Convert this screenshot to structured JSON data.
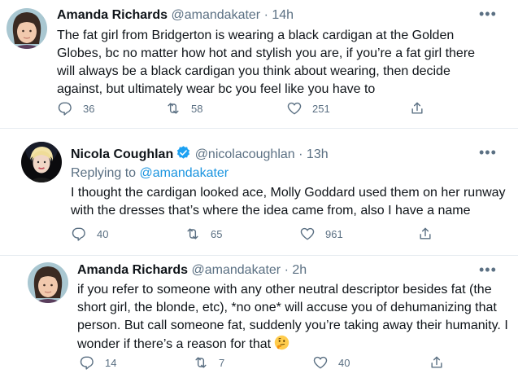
{
  "tweets": [
    {
      "name": "Amanda Richards",
      "handle": "@amandakater",
      "sep": "·",
      "time": "14h",
      "lines": [
        "The fat girl from Bridgerton is wearing a black cardigan at the Golden",
        "Globes, bc no matter how hot and stylish you are, if you’re a fat girl there",
        "will always be a black cardigan you think about wearing, then decide",
        "against, but ultimately wear bc you feel like you have to"
      ],
      "replies": "36",
      "retweets": "58",
      "likes": "251"
    },
    {
      "name": "Nicola Coughlan",
      "handle": "@nicolacoughlan",
      "sep": "·",
      "time": "13h",
      "replying_prefix": "Replying to",
      "replying_to": "@amandakater",
      "lines": [
        "I thought the cardigan looked ace, Molly Goddard used them on her runway",
        "with the dresses that’s where the idea came from, also I have a name"
      ],
      "replies": "40",
      "retweets": "65",
      "likes": "961"
    },
    {
      "name": "Amanda Richards",
      "handle": "@amandakater",
      "sep": "·",
      "time": "2h",
      "lines": [
        "if you refer to someone with any other neutral descriptor besides fat (the",
        "short girl, the blonde, etc), *no one* will accuse you of dehumanizing that",
        "person. But call someone fat, suddenly you’re taking away their humanity. I",
        "wonder if there’s a reason for that"
      ],
      "emoji": "thinking-face",
      "replies": "14",
      "retweets": "7",
      "likes": "40"
    }
  ],
  "more_label": "•••",
  "colors": {
    "secondary": "#5b7083",
    "link": "#1b95e0",
    "verified": "#1da1f2"
  }
}
